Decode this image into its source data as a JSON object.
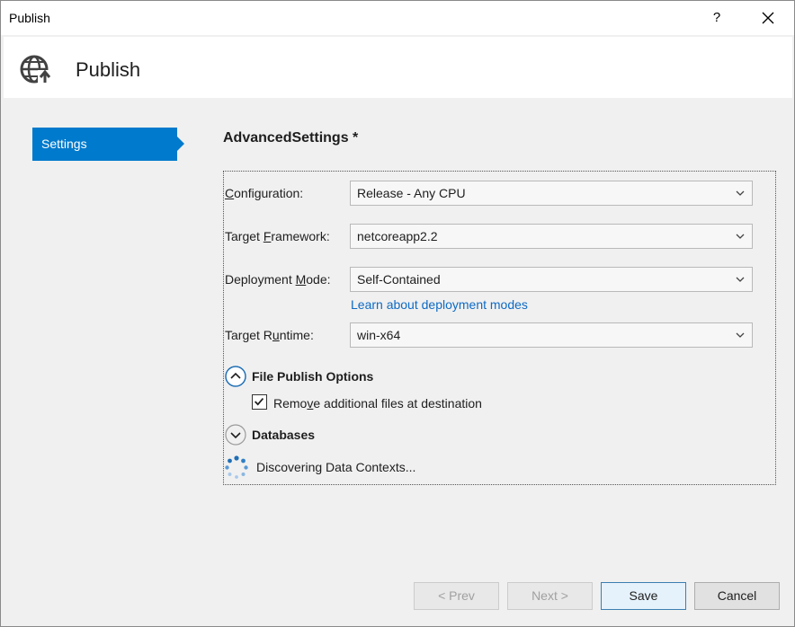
{
  "window": {
    "title": "Publish",
    "help_label": "?"
  },
  "header": {
    "title": "Publish",
    "icon": "globe-publish-icon"
  },
  "nav": {
    "items": [
      {
        "label": "Settings",
        "selected": true
      }
    ]
  },
  "settings": {
    "title": "AdvancedSettings *",
    "configuration": {
      "label_pre": "",
      "label_accel": "C",
      "label_post": "onfiguration:",
      "value": "Release - Any CPU"
    },
    "target_framework": {
      "label_pre": "Target ",
      "label_accel": "F",
      "label_post": "ramework:",
      "value": "netcoreapp2.2"
    },
    "deployment_mode": {
      "label_pre": "Deployment ",
      "label_accel": "M",
      "label_post": "ode:",
      "value": "Self-Contained",
      "link": "Learn about deployment modes"
    },
    "target_runtime": {
      "label_pre": "Target R",
      "label_accel": "u",
      "label_post": "ntime:",
      "value": "win-x64"
    },
    "file_publish": {
      "title": "File Publish Options",
      "expanded": true,
      "remove_files": {
        "label_pre": "Remo",
        "label_accel": "v",
        "label_post": "e additional files at destination",
        "checked": true
      }
    },
    "databases": {
      "title": "Databases",
      "expanded": false,
      "status": "Discovering Data Contexts..."
    }
  },
  "footer": {
    "prev_label": "< Prev",
    "next_label": "Next >",
    "save_label": "Save",
    "cancel_label": "Cancel"
  },
  "colors": {
    "accent": "#007acc",
    "link": "#0e6ac4"
  }
}
